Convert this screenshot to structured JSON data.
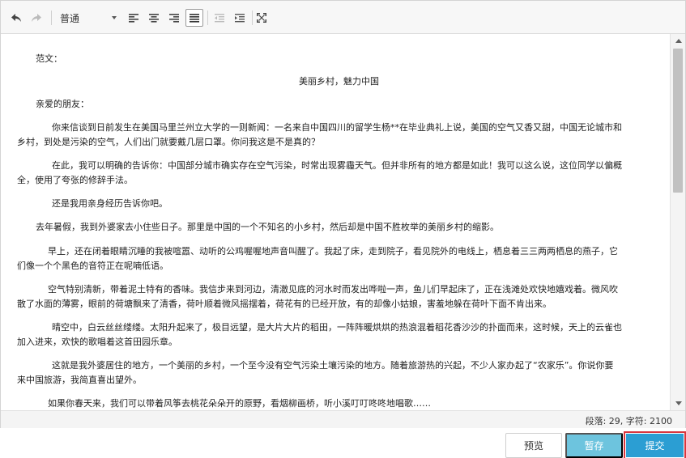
{
  "toolbar": {
    "format_select": "普通",
    "icons": [
      "undo-icon",
      "redo-icon",
      "align-left-icon",
      "align-center-icon",
      "align-right-icon",
      "align-justify-icon",
      "outdent-icon",
      "indent-icon",
      "fullscreen-icon"
    ]
  },
  "document": {
    "label": "范文：",
    "title": "美丽乡村，魅力中国",
    "greeting": "亲爱的朋友：",
    "paragraphs": [
      {
        "l1": "你来信谈到日前发生在美国马里兰州立大学的一则新闻：一名来自中国四川的留学生杨**在毕业典礼上说，美国的空气又香又甜，中国无论城市和",
        "l2": "乡村，到处是污染的空气，人们出门就要戴几层口罩。你问我这是不是真的？"
      },
      {
        "l1": "在此，我可以明确的告诉你：中国部分城市确实存在空气污染，时常出现雾霾天气。但并非所有的地方都是如此！我可以这么说，这位同学以偏概",
        "l2": "全，使用了夸张的修辞手法。"
      },
      {
        "l1": "还是我用亲身经历告诉你吧。",
        "l2": ""
      },
      {
        "l1": "去年暑假，我到外婆家去小住些日子。那里是中国的一个不知名的小乡村，然后却是中国不胜枚举的美丽乡村的缩影。",
        "l2": ""
      },
      {
        "l1": "早上，还在闭着眼睛沉睡的我被喧嚣、动听的公鸡喔喔地声音叫醒了。我起了床，走到院子，看见院外的电线上，栖息着三三两两栖息的燕子，它",
        "l2": "们像一个个黑色的音符正在呢喃低语。"
      },
      {
        "l1": "空气特别清新，带着泥土特有的香味。我信步来到河边，清澈见底的河水时而发出哗啦一声，鱼儿们早起床了，正在浅滩处欢快地嬉戏着。微风吹",
        "l2": "散了水面的薄雾，眼前的荷塘飘来了清香，荷叶顺着微风摇摆着，荷花有的已经开放，有的却像小姑娘，害羞地躲在荷叶下面不肯出来。"
      },
      {
        "l1": "晴空中，白云丝丝缕缕。太阳升起来了，极目远望，是大片大片的稻田，一阵阵暖烘烘的热浪混着稻花香沙沙的扑面而来，这时候，天上的云雀也",
        "l2": "加入进来，欢快的歌唱着这首田园乐章。"
      },
      {
        "l1": "这就是我外婆居住的地方，一个美丽的乡村，一个至今没有空气污染土壤污染的地方。随着旅游热的兴起，不少人家办起了“农家乐”。你说你要",
        "l2": "来中国旅游，我简直喜出望外。"
      },
      {
        "l1": "如果你春天来，我们可以带着风筝去桃花朵朵开的原野，看烟柳画桥，听小溪叮叮咚咚地唱歌……",
        "l2": ""
      }
    ]
  },
  "status": {
    "count_text": "段落: 29, 字符: 2100"
  },
  "buttons": {
    "preview": "预览",
    "save": "暂存",
    "submit": "提交"
  },
  "colors": {
    "save_bg": "#6dc4de",
    "submit_bg": "#2b9ed3",
    "submit_outline": "#d9363e"
  }
}
